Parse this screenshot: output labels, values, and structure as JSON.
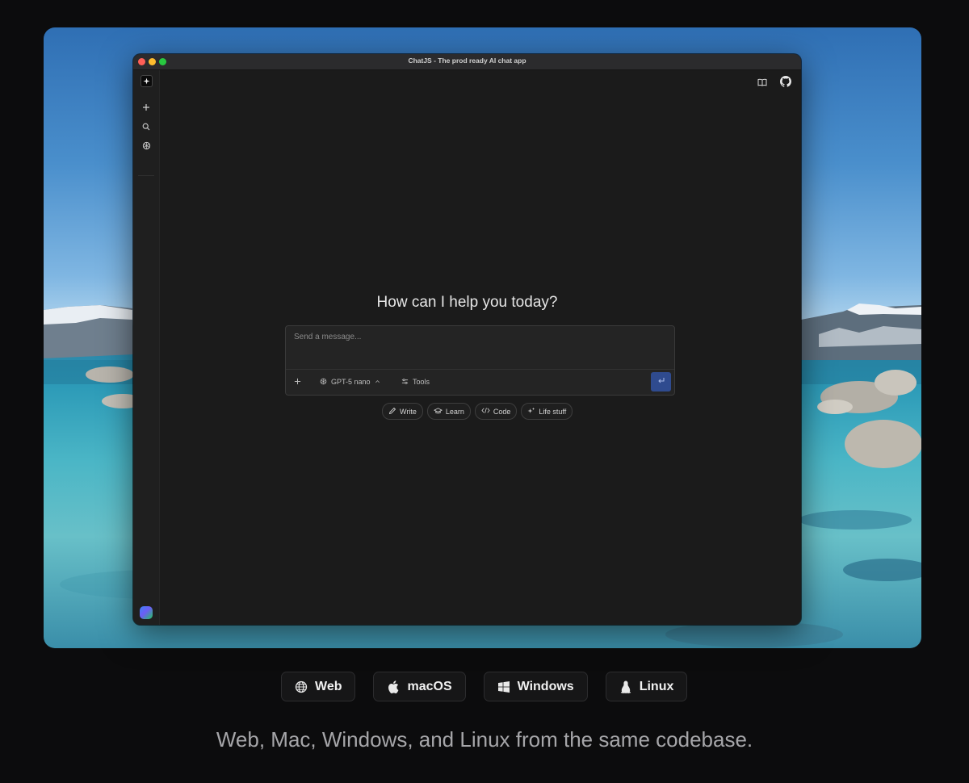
{
  "window": {
    "title": "ChatJS - The prod ready AI chat app"
  },
  "sidebar": {
    "logo_icon": "sparkle-logo-icon",
    "items": [
      {
        "icon": "plus-icon",
        "name": "new-chat"
      },
      {
        "icon": "search-icon",
        "name": "search"
      },
      {
        "icon": "openai-icon",
        "name": "models"
      }
    ]
  },
  "header": {
    "docs_icon": "book-icon",
    "github_icon": "github-icon"
  },
  "main": {
    "greeting": "How can I help you today?",
    "composer": {
      "placeholder": "Send a message...",
      "model_label": "GPT-5 nano",
      "tools_label": "Tools"
    },
    "suggestions": [
      {
        "label": "Write",
        "icon": "pencil-icon"
      },
      {
        "label": "Learn",
        "icon": "graduation-cap-icon"
      },
      {
        "label": "Code",
        "icon": "code-icon"
      },
      {
        "label": "Life stuff",
        "icon": "sparkles-icon"
      }
    ]
  },
  "platforms": [
    {
      "label": "Web",
      "icon": "globe-icon"
    },
    {
      "label": "macOS",
      "icon": "apple-icon"
    },
    {
      "label": "Windows",
      "icon": "windows-icon"
    },
    {
      "label": "Linux",
      "icon": "tux-icon"
    }
  ],
  "caption": "Web, Mac, Windows, and Linux from the same codebase.",
  "colors": {
    "page_bg": "#0c0c0d",
    "window_bg": "#1b1b1b",
    "send_button": "#2f4b8f"
  }
}
